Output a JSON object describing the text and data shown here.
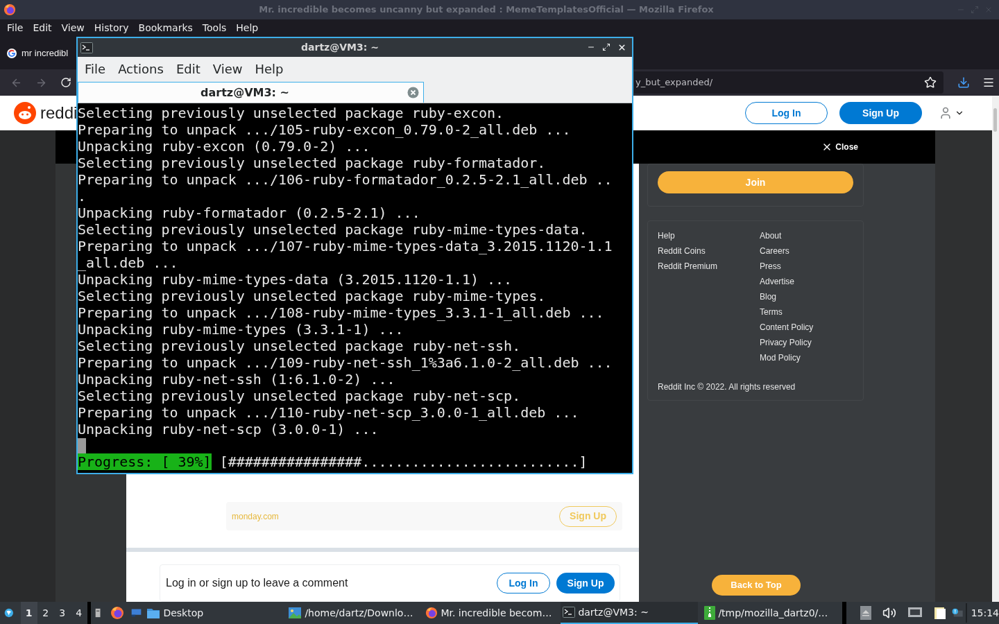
{
  "firefox": {
    "title": "Mr. incredible becomes uncanny but expanded : MemeTemplatesOfficial — Mozilla Firefox",
    "menu": [
      "File",
      "Edit",
      "View",
      "History",
      "Bookmarks",
      "Tools",
      "Help"
    ],
    "tab": {
      "title": "mr incredibl"
    },
    "url": "y_but_expanded/"
  },
  "reddit": {
    "logo_text": "reddi",
    "header_buttons": [
      {
        "label": "Log In",
        "kind": "outline"
      },
      {
        "label": "Sign Up",
        "kind": "solid"
      }
    ],
    "close": "Close",
    "join": "Join",
    "footer_links": {
      "column_1": [
        "Help",
        "Reddit Coins",
        "Reddit Premium"
      ],
      "column_2": [
        "About",
        "Careers",
        "Press",
        "Advertise",
        "Blog",
        "Terms",
        "Content Policy",
        "Privacy Policy",
        "Mod Policy"
      ]
    },
    "copyright": "Reddit Inc © 2022. All rights reserved",
    "back_to_top": "Back to Top",
    "ad": {
      "advertiser": "monday.com",
      "button": "Sign Up"
    },
    "comment_prompt": {
      "text": "Log in or sign up to leave a comment",
      "buttons": [
        {
          "label": "Log In",
          "kind": "outline"
        },
        {
          "label": "Sign Up",
          "kind": "solid"
        }
      ]
    }
  },
  "terminal": {
    "title": "dartz@VM3: ~",
    "menu": [
      "File",
      "Actions",
      "Edit",
      "View",
      "Help"
    ],
    "tab": {
      "title": "dartz@VM3: ~"
    },
    "lines": [
      "Selecting previously unselected package ruby-excon.",
      "Preparing to unpack .../105-ruby-excon_0.79.0-2_all.deb ...",
      "Unpacking ruby-excon (0.79.0-2) ...",
      "Selecting previously unselected package ruby-formatador.",
      "Preparing to unpack .../106-ruby-formatador_0.2.5-2.1_all.deb ..",
      ".",
      "Unpacking ruby-formatador (0.2.5-2.1) ...",
      "Selecting previously unselected package ruby-mime-types-data.",
      "Preparing to unpack .../107-ruby-mime-types-data_3.2015.1120-1.1",
      "_all.deb ...",
      "Unpacking ruby-mime-types-data (3.2015.1120-1.1) ...",
      "Selecting previously unselected package ruby-mime-types.",
      "Preparing to unpack .../108-ruby-mime-types_3.3.1-1_all.deb ...",
      "Unpacking ruby-mime-types (3.3.1-1) ...",
      "Selecting previously unselected package ruby-net-ssh.",
      "Preparing to unpack .../109-ruby-net-ssh_1%3a6.1.0-2_all.deb ...",
      "Unpacking ruby-net-ssh (1:6.1.0-2) ...",
      "Selecting previously unselected package ruby-net-scp.",
      "Preparing to unpack .../110-ruby-net-scp_3.0.0-1_all.deb ...",
      "Unpacking ruby-net-scp (3.0.0-1) ..."
    ],
    "progress": {
      "label": "Progress: [ 39%]",
      "bar": "[################..........................]"
    }
  },
  "taskbar": {
    "workspaces": [
      {
        "label": "1",
        "selected": true
      },
      {
        "label": "2",
        "selected": false
      },
      {
        "label": "3",
        "selected": false
      },
      {
        "label": "4",
        "selected": false
      }
    ],
    "tasks": [
      {
        "label": "Desktop",
        "kind": "folder",
        "selected": false
      },
      {
        "label": "/home/dartz/Downlo…",
        "kind": "image",
        "selected": false
      },
      {
        "label": "Mr. incredible becom…",
        "kind": "browser",
        "selected": false
      },
      {
        "label": "dartz@VM3: ~",
        "kind": "terminal",
        "selected": true
      },
      {
        "label": "/tmp/mozilla_dartz0/…",
        "kind": "archive",
        "selected": false
      }
    ],
    "clock": "15:14"
  }
}
